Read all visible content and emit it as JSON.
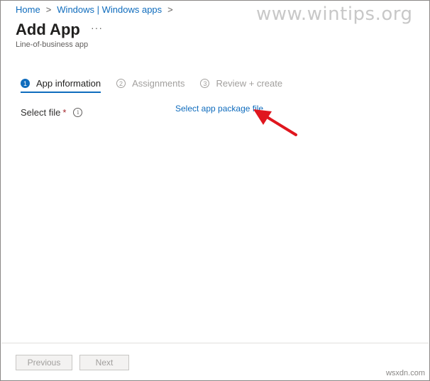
{
  "breadcrumb": {
    "items": [
      "Home",
      "Windows | Windows apps"
    ],
    "separator": ">"
  },
  "header": {
    "title": "Add App",
    "subtitle": "Line-of-business app",
    "more": "···"
  },
  "watermark": {
    "top": "www.wintips.org",
    "bottom": "wsxdn.com"
  },
  "wizard": {
    "steps": [
      {
        "number": "1",
        "label": "App information",
        "state": "active"
      },
      {
        "number": "2",
        "label": "Assignments",
        "state": "inactive"
      },
      {
        "number": "3",
        "label": "Review + create",
        "state": "inactive"
      }
    ]
  },
  "form": {
    "select_file_label": "Select file",
    "required_mark": "*",
    "info_icon": "i",
    "select_file_link": "Select app package file"
  },
  "footer": {
    "previous_label": "Previous",
    "next_label": "Next"
  },
  "colors": {
    "accent": "#0f6cbd",
    "arrow": "#e0161e",
    "required": "#a4262c"
  }
}
